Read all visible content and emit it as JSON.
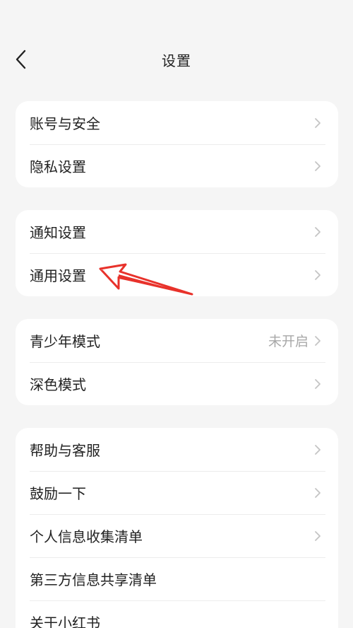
{
  "header": {
    "title": "设置",
    "back_icon": "chevron-left-icon"
  },
  "groups": [
    {
      "items": [
        {
          "label": "账号与安全",
          "value": ""
        },
        {
          "label": "隐私设置",
          "value": ""
        }
      ]
    },
    {
      "items": [
        {
          "label": "通知设置",
          "value": ""
        },
        {
          "label": "通用设置",
          "value": ""
        }
      ]
    },
    {
      "items": [
        {
          "label": "青少年模式",
          "value": "未开启"
        },
        {
          "label": "深色模式",
          "value": ""
        }
      ]
    },
    {
      "items": [
        {
          "label": "帮助与客服",
          "value": ""
        },
        {
          "label": "鼓励一下",
          "value": ""
        },
        {
          "label": "个人信息收集清单",
          "value": ""
        },
        {
          "label": "第三方信息共享清单",
          "value": ""
        },
        {
          "label": "关于小红书",
          "value": ""
        }
      ]
    }
  ],
  "colors": {
    "background": "#f5f5f5",
    "card": "#ffffff",
    "text": "#222222",
    "muted": "#a8a8a8",
    "annotation_arrow": "#e8322b"
  }
}
